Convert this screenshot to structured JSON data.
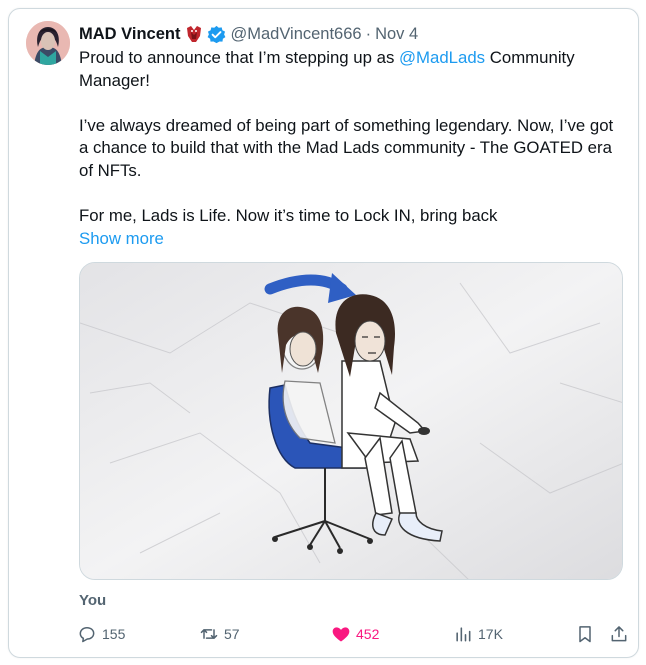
{
  "tweet": {
    "author_name": "MAD Vincent",
    "emoji": "red-character-emoji",
    "verified_icon": "verified-badge-icon",
    "handle": "@MadVincent666",
    "separator": "·",
    "date": "Nov 4",
    "text_line1_prefix": "Proud to announce that I’m stepping up as ",
    "mention": "@MadLads",
    "text_line1_suffix": " Community Manager!",
    "paragraph2": "I’ve always dreamed of being part of something legendary. Now, I’ve got a chance to build that with the Mad Lads community - The GOATED era of NFTs.",
    "paragraph3": "For me, Lads is Life. Now it’s time to Lock IN, bring back",
    "show_more": "Show more",
    "image_alt_icon": "sketch-illustration-chair-two-figures",
    "tagged_user": "You"
  },
  "actions": {
    "replies": "155",
    "reposts": "57",
    "likes": "452",
    "views": "17K",
    "reply_icon": "reply-icon",
    "repost_icon": "repost-icon",
    "like_icon": "heart-icon",
    "views_icon": "views-icon",
    "bookmark_icon": "bookmark-icon",
    "share_icon": "share-icon"
  },
  "colors": {
    "link_blue": "#1d9bf0",
    "like_pink": "#f91880",
    "secondary_text": "#536471",
    "chair_blue": "#2b55b8",
    "arrow_blue": "#2f5fc4"
  }
}
